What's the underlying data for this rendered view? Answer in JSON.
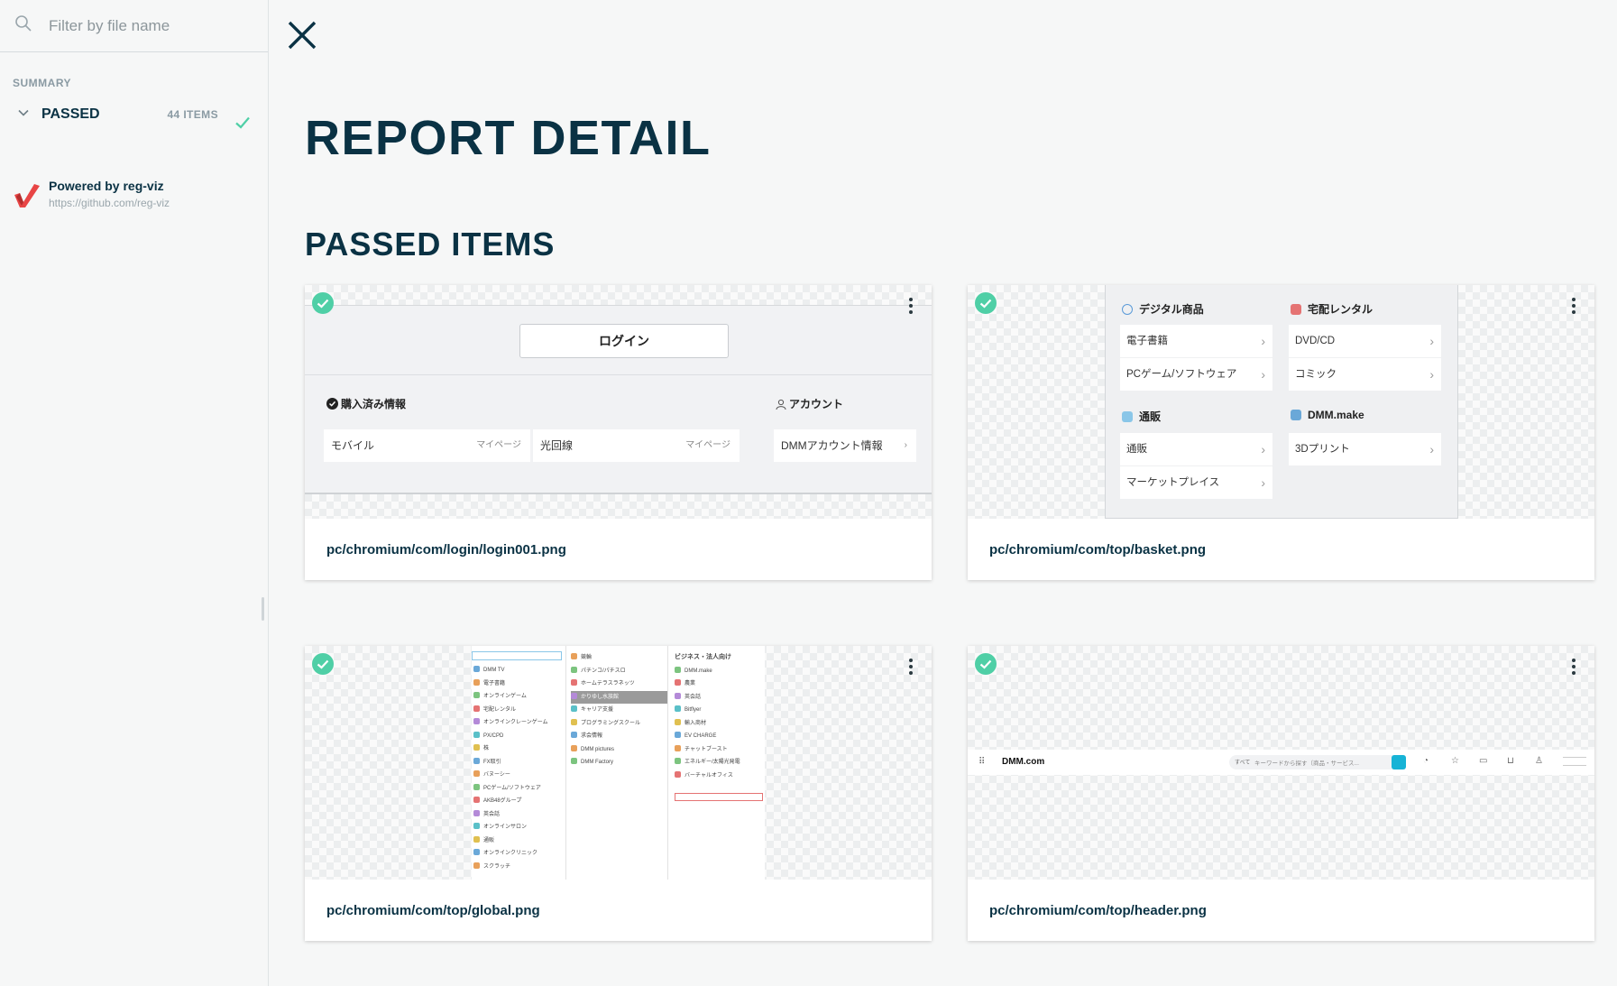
{
  "sidebar": {
    "search_placeholder": "Filter by file name",
    "summary_label": "SUMMARY",
    "passed_label": "PASSED",
    "passed_count": "44 ITEMS",
    "powered_by": "Powered by reg-viz",
    "powered_url": "https://github.com/reg-viz"
  },
  "main": {
    "title": "REPORT DETAIL",
    "section_title": "PASSED ITEMS"
  },
  "cards": [
    {
      "filename": "pc/chromium/com/login/login001.png"
    },
    {
      "filename": "pc/chromium/com/top/basket.png"
    },
    {
      "filename": "pc/chromium/com/top/global.png"
    },
    {
      "filename": "pc/chromium/com/top/header.png"
    }
  ],
  "preview_login": {
    "login_button": "ログイン",
    "purchased_heading": "購入済み情報",
    "account_heading": "アカウント",
    "mobile": "モバイル",
    "mobile_link": "マイページ",
    "fiber": "光回線",
    "fiber_link": "マイページ",
    "account_info": "DMMアカウント情報"
  },
  "preview_basket": {
    "digital_heading": "デジタル商品",
    "rental_heading": "宅配レンタル",
    "ebook": "電子書籍",
    "pcgame": "PCゲーム/ソフトウェア",
    "dvd": "DVD/CD",
    "comic": "コミック",
    "mailorder_heading": "通販",
    "make_heading": "DMM.make",
    "mailorder": "通販",
    "marketplace": "マーケットプレイス",
    "print3d": "3Dプリント"
  },
  "preview_global": {
    "col1": [
      "DMM TV",
      "電子書籍",
      "オンラインゲーム",
      "宅配レンタル",
      "オンラインクレーンゲーム",
      "PX/CPD",
      "株",
      "FX取引",
      "バヌーシー",
      "PCゲーム/ソフトウェア",
      "AKB48グループ",
      "英会話",
      "オンラインサロン",
      "通販",
      "オンラインクリニック",
      "スクラッチ"
    ],
    "col2": [
      "競輪",
      "パチンコ/パチスロ",
      "ホームテラスラネッツ",
      "かりゆし水族館",
      "キャリア支援",
      "プログラミングスクール",
      "求会情報",
      "DMM pictures",
      "DMM Factory"
    ],
    "col3_heading": "ビジネス・法人向け",
    "col3": [
      "DMM.make",
      "農業",
      "英会話",
      "Bitflyer",
      "輸入商材",
      "EV CHARGE",
      "チャットブースト",
      "エネルギー/太陽光発電",
      "バーチャルオフィス"
    ]
  },
  "preview_header": {
    "logo": "DMM.com",
    "category": "すべて",
    "search_placeholder": "キーワードから探す（商品・サービス..."
  },
  "colors": {
    "accent": "#4fcfa6",
    "text": "#0a3244",
    "logo_red": "#e84545"
  }
}
